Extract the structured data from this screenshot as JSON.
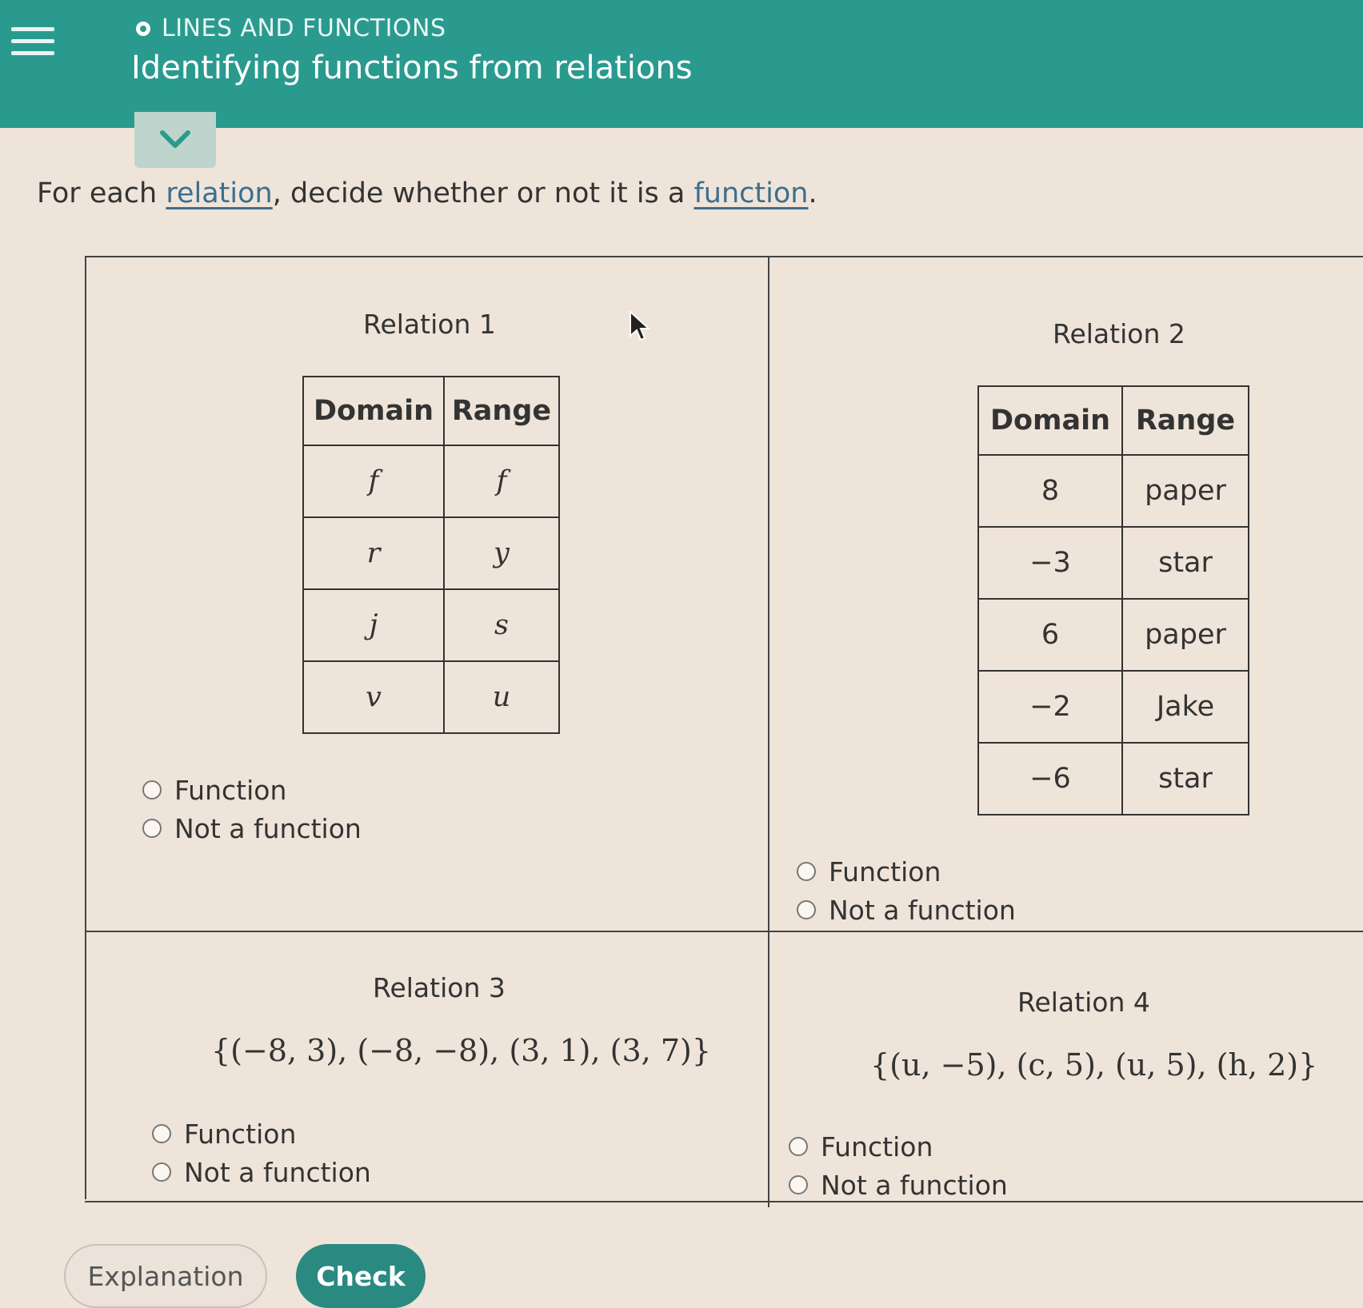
{
  "header": {
    "topic": "LINES AND FUNCTIONS",
    "title": "Identifying functions from relations"
  },
  "instruction": {
    "prefix": "For each ",
    "link1": "relation",
    "middle": ", decide whether or not it is a ",
    "link2": "function",
    "suffix": "."
  },
  "relation1": {
    "title": "Relation 1",
    "headers": [
      "Domain",
      "Range"
    ],
    "rows": [
      [
        "f",
        "f"
      ],
      [
        "r",
        "y"
      ],
      [
        "j",
        "s"
      ],
      [
        "v",
        "u"
      ]
    ]
  },
  "relation2": {
    "title": "Relation 2",
    "headers": [
      "Domain",
      "Range"
    ],
    "rows": [
      [
        "8",
        "paper"
      ],
      [
        "−3",
        "star"
      ],
      [
        "6",
        "paper"
      ],
      [
        "−2",
        "Jake"
      ],
      [
        "−6",
        "star"
      ]
    ]
  },
  "relation3": {
    "title": "Relation 3",
    "set": "{(−8, 3), (−8, −8), (3, 1), (3, 7)}"
  },
  "relation4": {
    "title": "Relation 4",
    "set": "{(u, −5), (c, 5), (u, 5), (h, 2)}"
  },
  "options": {
    "function": "Function",
    "not_function": "Not a function"
  },
  "buttons": {
    "explanation": "Explanation",
    "check": "Check"
  }
}
